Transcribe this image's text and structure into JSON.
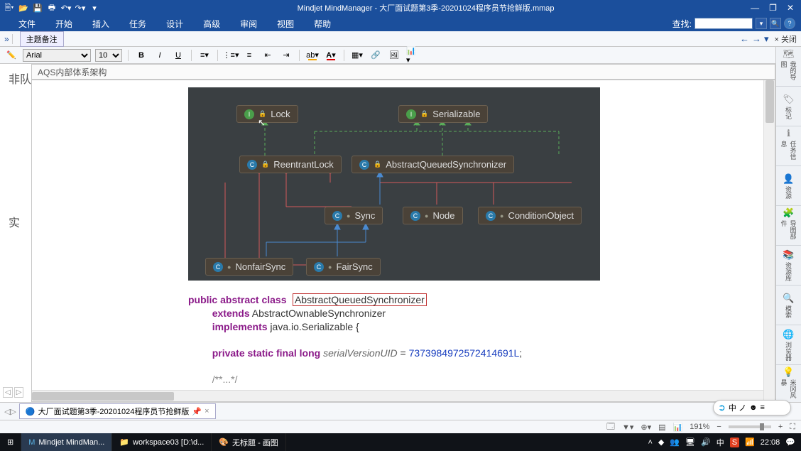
{
  "titlebar": {
    "app_title": "Mindjet MindManager - 大厂面试题第3季-20201024程序员节抢鲜版.mmap"
  },
  "menubar": {
    "items": [
      "文件",
      "开始",
      "插入",
      "任务",
      "设计",
      "高级",
      "审阅",
      "视图",
      "帮助"
    ],
    "search_label": "查找:"
  },
  "ribbon1": {
    "tab_label": "主题备注",
    "close_label": "× 关闭"
  },
  "ribbon2": {
    "font_name": "Arial",
    "font_size": "10"
  },
  "breadcrumb": "AQS内部体系架构",
  "diagram": {
    "nodes": {
      "lock": "Lock",
      "serializable": "Serializable",
      "reentrant": "ReentrantLock",
      "aqs": "AbstractQueuedSynchronizer",
      "sync": "Sync",
      "node": "Node",
      "cond": "ConditionObject",
      "nonfair": "NonfairSync",
      "fair": "FairSync"
    }
  },
  "code": {
    "l1_kw": "public abstract class",
    "l1_box": "AbstractQueuedSynchronizer",
    "l2_kw": "extends",
    "l2_rest": " AbstractOwnableSynchronizer",
    "l3_kw": "implements",
    "l3_rest": " java.io.Serializable {",
    "l4_kw": "private static final long",
    "l4_var": " serialVersionUID",
    "l4_eq": " = ",
    "l4_num": "7373984972572414691L",
    "l4_semi": ";",
    "l5": "/**...*/"
  },
  "right_panel": {
    "items": [
      "我的导图",
      "标记",
      "任务信息",
      "资源",
      "导图部件",
      "资源库",
      "模索",
      "浏览器",
      "米冈风暴"
    ]
  },
  "doctabs": {
    "tab1": "大厂面试题第3季-20201024程序员节抢鲜版"
  },
  "statusbar": {
    "zoom": "191%"
  },
  "taskbar": {
    "items": [
      "Mindjet MindMan...",
      "workspace03 [D:\\d...",
      "无标题 - 画图"
    ],
    "time": "22:08"
  },
  "ime": {
    "text": "中 ノ "
  },
  "left_sidebar": {
    "t1": "非队",
    "t2": "实"
  }
}
